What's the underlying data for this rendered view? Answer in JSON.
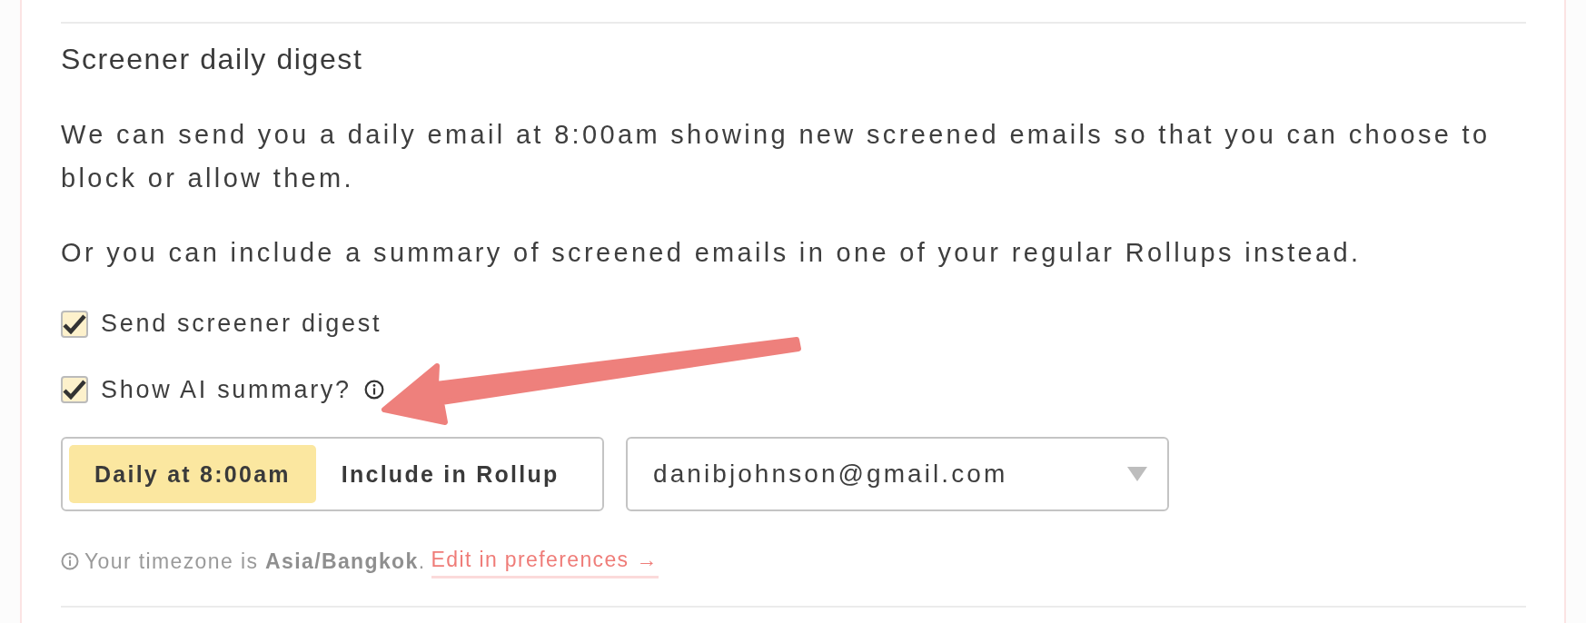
{
  "section": {
    "title": "Screener daily digest",
    "paragraphs": [
      "We can send you a daily email at 8:00am showing new screened emails so that you can choose to block or allow them.",
      "Or you can include a summary of screened emails in one of your regular Rollups instead."
    ],
    "checkboxes": [
      {
        "label": "Send screener digest",
        "checked": true,
        "info": false
      },
      {
        "label": "Show AI summary?",
        "checked": true,
        "info": true
      }
    ],
    "schedule": [
      {
        "label": "Daily at 8:00am",
        "selected": true
      },
      {
        "label": "Include in Rollup",
        "selected": false
      }
    ],
    "email_select": {
      "value": "danibjohnson@gmail.com"
    },
    "note": {
      "text": "Your timezone is **Asia/Bangkok**.",
      "link": "Edit in preferences →"
    }
  }
}
